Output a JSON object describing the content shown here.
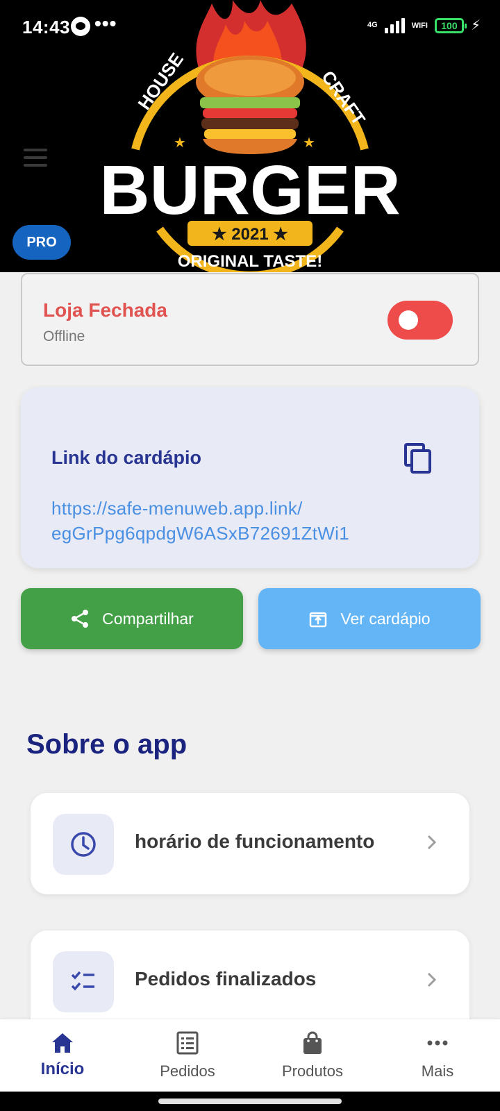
{
  "status_bar": {
    "time": "14:43",
    "dots": "•••",
    "network": "4G",
    "wifi": "WIFI",
    "battery": "100"
  },
  "header": {
    "logo_alt": "House Craft Burger",
    "logo_text_top_left": "HOUSE",
    "logo_text_top_right": "CRAFT",
    "logo_text_main": "BURGER",
    "logo_year": "★ 2021 ★",
    "logo_text_bottom": "ORIGINAL TASTE!",
    "pro_badge": "PRO"
  },
  "store_status": {
    "title": "Loja Fechada",
    "subtitle": "Offline",
    "is_open": false
  },
  "link_card": {
    "title": "Link do cardápio",
    "url_line1": "https://safe-menuweb.app.link/",
    "url_line2": "egGrPpg6qpdgW6ASxB72691ZtWi1"
  },
  "buttons": {
    "share_label": "Compartilhar",
    "view_label": "Ver cardápio"
  },
  "about": {
    "title": "Sobre o app",
    "items": [
      {
        "label": "horário de funcionamento",
        "icon": "clock-icon"
      },
      {
        "label": "Pedidos finalizados",
        "icon": "checklist-icon"
      }
    ]
  },
  "bottom_nav": {
    "items": [
      {
        "label": "Início",
        "icon": "home-icon",
        "active": true
      },
      {
        "label": "Pedidos",
        "icon": "receipt-icon",
        "active": false
      },
      {
        "label": "Produtos",
        "icon": "bag-icon",
        "active": false
      },
      {
        "label": "Mais",
        "icon": "more-icon",
        "active": false
      }
    ]
  },
  "colors": {
    "primary": "#283593",
    "closed_red": "#e05350",
    "share_green": "#43a047",
    "view_blue": "#64b5f6",
    "link_blue": "#4a90e2",
    "pro_blue": "#1565c0"
  }
}
